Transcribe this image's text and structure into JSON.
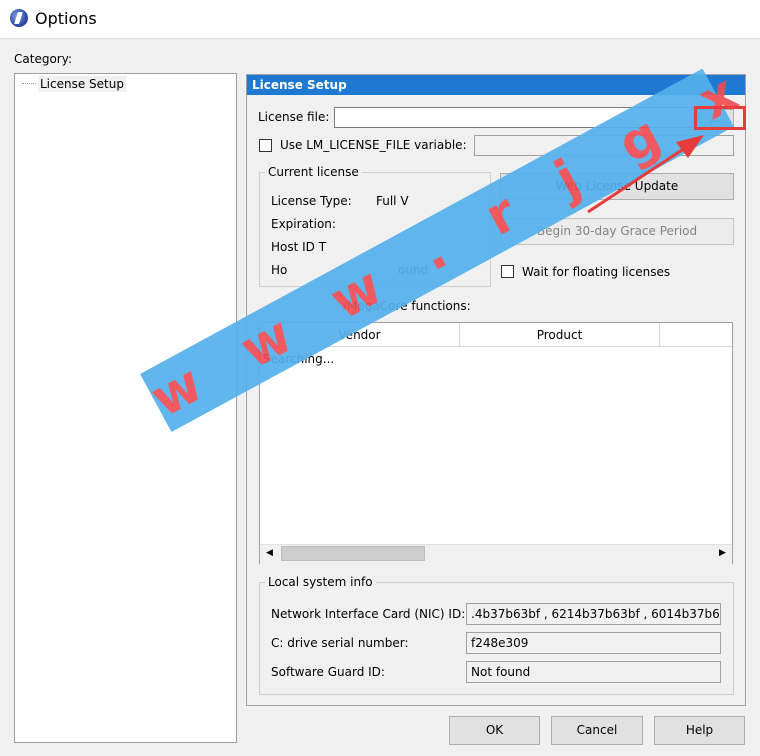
{
  "window": {
    "title": "Options"
  },
  "category": {
    "label": "Category:",
    "tree_items": [
      "License Setup"
    ]
  },
  "panel": {
    "header": "License Setup",
    "license_file": {
      "label": "License file:",
      "value": "",
      "browse_label": "..."
    },
    "use_env": {
      "label": "Use LM_LICENSE_FILE variable:",
      "checked": false,
      "value": ""
    },
    "current_license": {
      "title": "Current license",
      "rows": [
        {
          "label": "License Type:",
          "value": "Full V"
        },
        {
          "label": "Expiration:",
          "value": ""
        },
        {
          "label": "Host ID T",
          "value": ""
        },
        {
          "label": "Ho",
          "value": "ound"
        }
      ]
    },
    "web_update_label": "Web License Update",
    "grace_period_label": "Begin 30-day Grace Period",
    "wait_floating": {
      "label": "Wait for floating licenses",
      "checked": false
    },
    "features_label": "/MegaCore functions:",
    "list": {
      "columns": [
        "Vendor",
        "Product"
      ],
      "rows": [
        "Searching..."
      ]
    },
    "local_info": {
      "title": "Local system info",
      "nic": {
        "label": "Network Interface Card (NIC) ID:",
        "value": ".4b37b63bf , 6214b37b63bf , 6014b37b63bf"
      },
      "drive": {
        "label": "C: drive serial number:",
        "value": "f248e309"
      },
      "guard": {
        "label": "Software Guard ID:",
        "value": "Not found"
      }
    }
  },
  "footer": {
    "ok": "OK",
    "cancel": "Cancel",
    "help": "Help"
  },
  "watermark": {
    "text": "w w w . r j g x g j . c o m"
  },
  "colors": {
    "header": "#1f79d2",
    "watermark_band": "#54b1ec",
    "watermark_text": "#ef4d53",
    "highlight": "#e83b3b"
  }
}
